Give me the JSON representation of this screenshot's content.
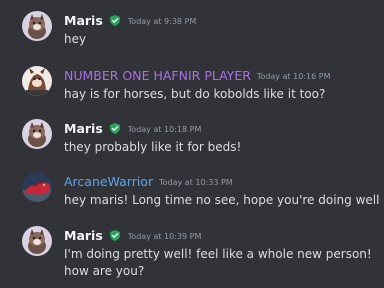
{
  "messages": [
    {
      "author": "Maris",
      "badge": "hypesquad-badge-icon",
      "timestamp": "Today at 9:38 PM",
      "lines": [
        "hey"
      ]
    },
    {
      "author": "NUMBER ONE HAFNIR PLAYER",
      "timestamp": "Today at 10:16 PM",
      "lines": [
        "hay is for horses, but do kobolds like it too?"
      ]
    },
    {
      "author": "Maris",
      "badge": "hypesquad-badge-icon",
      "timestamp": "Today at 10:18 PM",
      "lines": [
        "they probably like it for beds!"
      ]
    },
    {
      "author": "ArcaneWarrior",
      "timestamp": "Today at 10:33 PM",
      "lines": [
        "hey maris! Long time no see, hope you're doing well"
      ]
    },
    {
      "author": "Maris",
      "badge": "hypesquad-badge-icon",
      "timestamp": "Today at 10:39 PM",
      "lines": [
        "I'm doing pretty well! feel like a whole new person!",
        "how are you?"
      ]
    }
  ],
  "colors": {
    "background": "#313338",
    "name_default": "#f2f3f5",
    "name_purple": "#a970e8",
    "name_blue": "#5ba4ea",
    "badge_green": "#23a55a",
    "timestamp": "#949ba4",
    "text": "#dbdee1"
  }
}
